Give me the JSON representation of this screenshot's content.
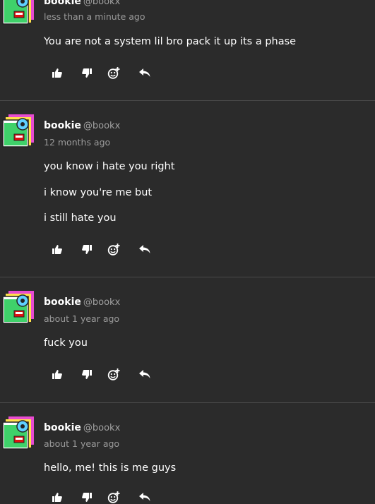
{
  "posts": [
    {
      "author": "bookie",
      "handle": "@bookx",
      "time": "less than a minute ago",
      "lines": [
        "You are not a system lil bro pack it up its a phase"
      ]
    },
    {
      "author": "bookie",
      "handle": "@bookx",
      "time": "12 months ago",
      "lines": [
        "you know i hate you right",
        "i know you're me but",
        "i still hate you"
      ]
    },
    {
      "author": "bookie",
      "handle": "@bookx",
      "time": "about 1 year ago",
      "lines": [
        "fuck you"
      ]
    },
    {
      "author": "bookie",
      "handle": "@bookx",
      "time": "about 1 year ago",
      "lines": [
        "hello, me! this is me guys"
      ]
    }
  ],
  "actions": [
    {
      "name": "like-button",
      "icon": "thumbs-up-icon"
    },
    {
      "name": "dislike-button",
      "icon": "thumbs-down-icon"
    },
    {
      "name": "add-reaction-button",
      "icon": "add-emoji-icon"
    },
    {
      "name": "reply-button",
      "icon": "reply-arrow-icon"
    }
  ],
  "colors": {
    "background": "#2b2b2b",
    "divider": "#4a4a4a",
    "text": "#ffffff",
    "muted": "#9a9a9a"
  }
}
